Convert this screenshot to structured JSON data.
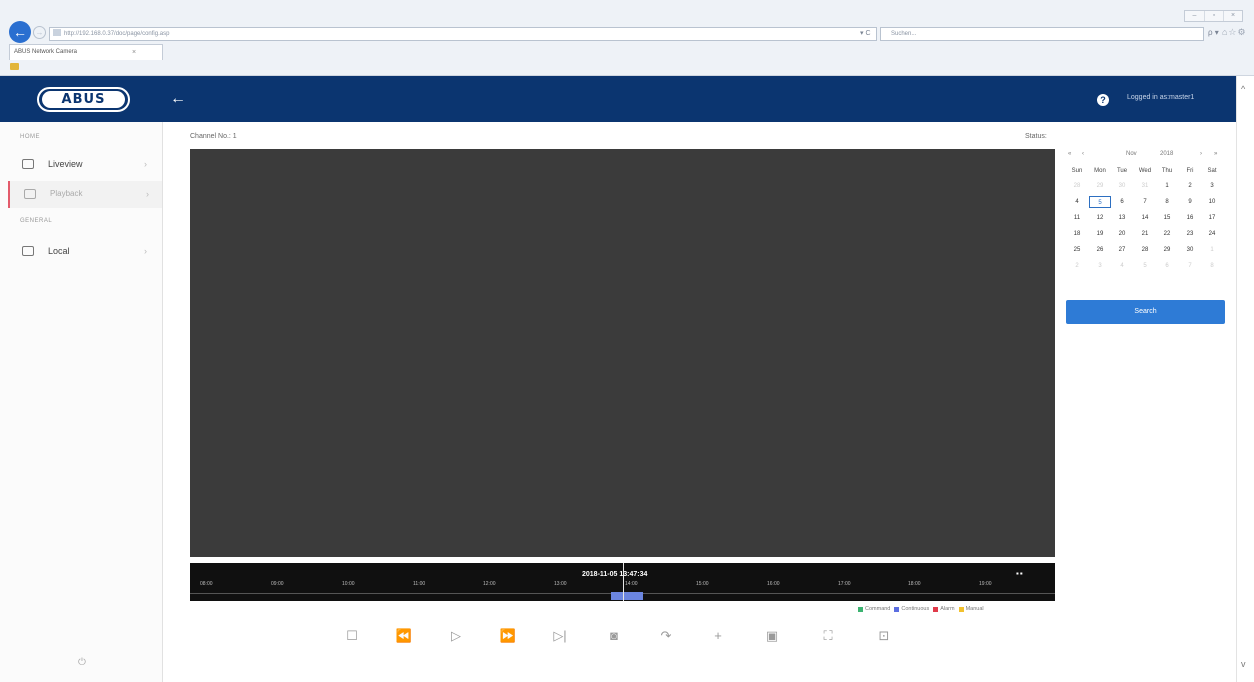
{
  "browser": {
    "url": "http://192.168.0.37/doc/page/config.asp",
    "search_placeholder": "Suchen...",
    "refresh": "▾ C",
    "search_icon": "ρ ▾",
    "tab_title": "ABUS Network Camera",
    "tab_close": "×",
    "back": "←",
    "forward": "→",
    "toolbar_icons": "⌂☆⚙",
    "window_controls": [
      "–",
      "▫",
      "×"
    ]
  },
  "header": {
    "logo": "ABUS",
    "back": "←",
    "help": "?",
    "logged_in": "Logged in as:master1"
  },
  "sidebar": {
    "section_home": "HOME",
    "section_general": "GENERAL",
    "items": [
      {
        "label": "Liveview",
        "icon": "camera-eye-icon"
      },
      {
        "label": "Playback",
        "icon": "playback-icon"
      },
      {
        "label": "Local",
        "icon": "monitor-icon"
      }
    ],
    "chevron": "›",
    "power": "⏻"
  },
  "main": {
    "channel_label": "Channel No.: 1",
    "status_label": "Status:"
  },
  "timeline": {
    "timestamp": "2018-11-05 13:47:34",
    "ticks": [
      "08:00",
      "09:00",
      "10:00",
      "11:00",
      "12:00",
      "13:00",
      "14:00",
      "15:00",
      "16:00",
      "17:00",
      "18:00",
      "19:00"
    ],
    "zoom": "▪▪"
  },
  "legend": [
    {
      "label": "Command",
      "color": "#3cb371"
    },
    {
      "label": "Continuous",
      "color": "#5b6ee1"
    },
    {
      "label": "Alarm",
      "color": "#e03a4a"
    },
    {
      "label": "Manual",
      "color": "#f2c12e"
    }
  ],
  "controls": [
    {
      "name": "stop-button",
      "glyph": "☐"
    },
    {
      "name": "slow-forward-button",
      "glyph": "⏪"
    },
    {
      "name": "play-button",
      "glyph": "▷"
    },
    {
      "name": "fast-forward-button",
      "glyph": "⏩"
    },
    {
      "name": "single-frame-button",
      "glyph": "▷|"
    },
    {
      "name": "capture-button",
      "glyph": "◙"
    },
    {
      "name": "clip-button",
      "glyph": "↷"
    },
    {
      "name": "zoom-button",
      "glyph": "+"
    },
    {
      "name": "download-button",
      "glyph": "▣"
    },
    {
      "name": "fullscreen-button",
      "glyph": "⛶"
    },
    {
      "name": "export-button",
      "glyph": "⊡"
    }
  ],
  "calendar": {
    "nav_prev_year": "«",
    "nav_prev_month": "‹",
    "month": "Nov",
    "year": "2018",
    "nav_next_month": "›",
    "nav_next_year": "»",
    "weekdays": [
      "Sun",
      "Mon",
      "Tue",
      "Wed",
      "Thu",
      "Fri",
      "Sat"
    ],
    "weeks": [
      [
        "28",
        "29",
        "30",
        "31",
        "1",
        "2",
        "3"
      ],
      [
        "4",
        "5",
        "6",
        "7",
        "8",
        "9",
        "10"
      ],
      [
        "11",
        "12",
        "13",
        "14",
        "15",
        "16",
        "17"
      ],
      [
        "18",
        "19",
        "20",
        "21",
        "22",
        "23",
        "24"
      ],
      [
        "25",
        "26",
        "27",
        "28",
        "29",
        "30",
        "1"
      ],
      [
        "2",
        "3",
        "4",
        "5",
        "6",
        "7",
        "8"
      ]
    ],
    "selected": "5",
    "search_label": "Search"
  },
  "scrollbar": {
    "up": "^",
    "down": "v"
  }
}
